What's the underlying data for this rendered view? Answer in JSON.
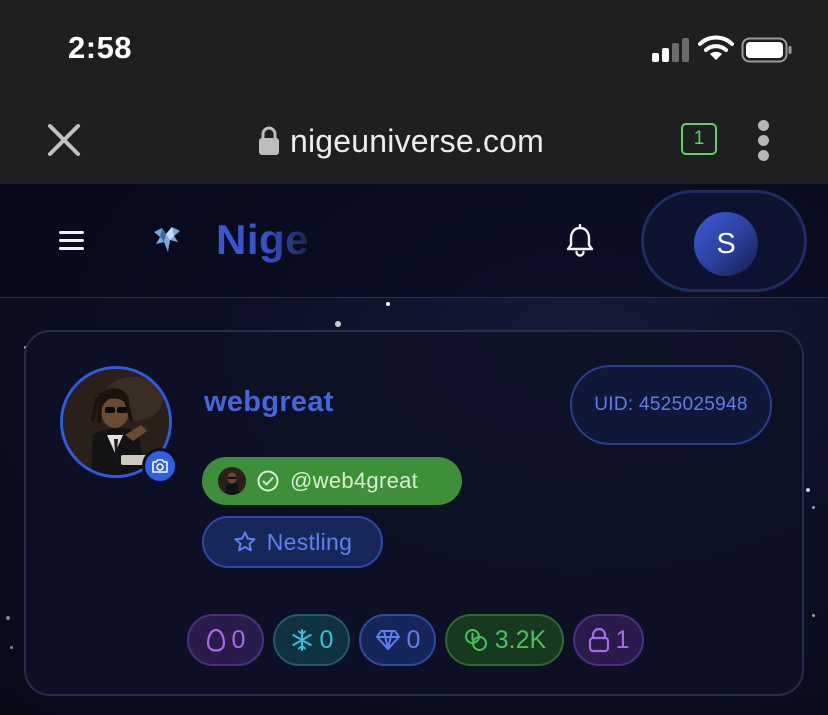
{
  "status_bar": {
    "time": "2:58"
  },
  "browser": {
    "domain": "nigeuniverse.com",
    "tab_count": "1"
  },
  "header": {
    "brand": "Nige",
    "account_initial": "S"
  },
  "profile": {
    "username": "webgreat",
    "uid": "UID: 4525025948",
    "handle": "@web4great",
    "rank": "Nestling"
  },
  "stats": [
    {
      "icon": "egg-icon",
      "value": "0",
      "color": "#a66ce8"
    },
    {
      "icon": "snowflake-icon",
      "value": "0",
      "color": "#35c2df"
    },
    {
      "icon": "diamond-icon",
      "value": "0",
      "color": "#5b7ff0"
    },
    {
      "icon": "coins-icon",
      "value": "3.2K",
      "color": "#4fbf5a"
    },
    {
      "icon": "lock-icon",
      "value": "1",
      "color": "#a66ce8"
    }
  ]
}
